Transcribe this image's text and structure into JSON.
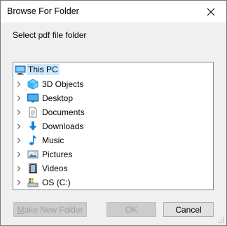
{
  "window": {
    "title": "Browse For Folder",
    "instruction": "Select pdf file folder"
  },
  "tree": {
    "root": {
      "label": "This PC",
      "icon": "this-pc-icon",
      "selected": true
    },
    "items": [
      {
        "label": "3D Objects",
        "icon": "3d-objects-icon"
      },
      {
        "label": "Desktop",
        "icon": "desktop-icon"
      },
      {
        "label": "Documents",
        "icon": "documents-icon"
      },
      {
        "label": "Downloads",
        "icon": "downloads-icon"
      },
      {
        "label": "Music",
        "icon": "music-icon"
      },
      {
        "label": "Pictures",
        "icon": "pictures-icon"
      },
      {
        "label": "Videos",
        "icon": "videos-icon"
      },
      {
        "label": "OS (C:)",
        "icon": "drive-icon"
      }
    ]
  },
  "buttons": {
    "make_new_folder_accel": "M",
    "make_new_folder_rest": "ake New Folder",
    "make_new_folder_enabled": false,
    "ok": "OK",
    "ok_enabled": false,
    "cancel": "Cancel"
  },
  "colors": {
    "selection": "#cce8ff",
    "accent_blue": "#0078d7"
  }
}
